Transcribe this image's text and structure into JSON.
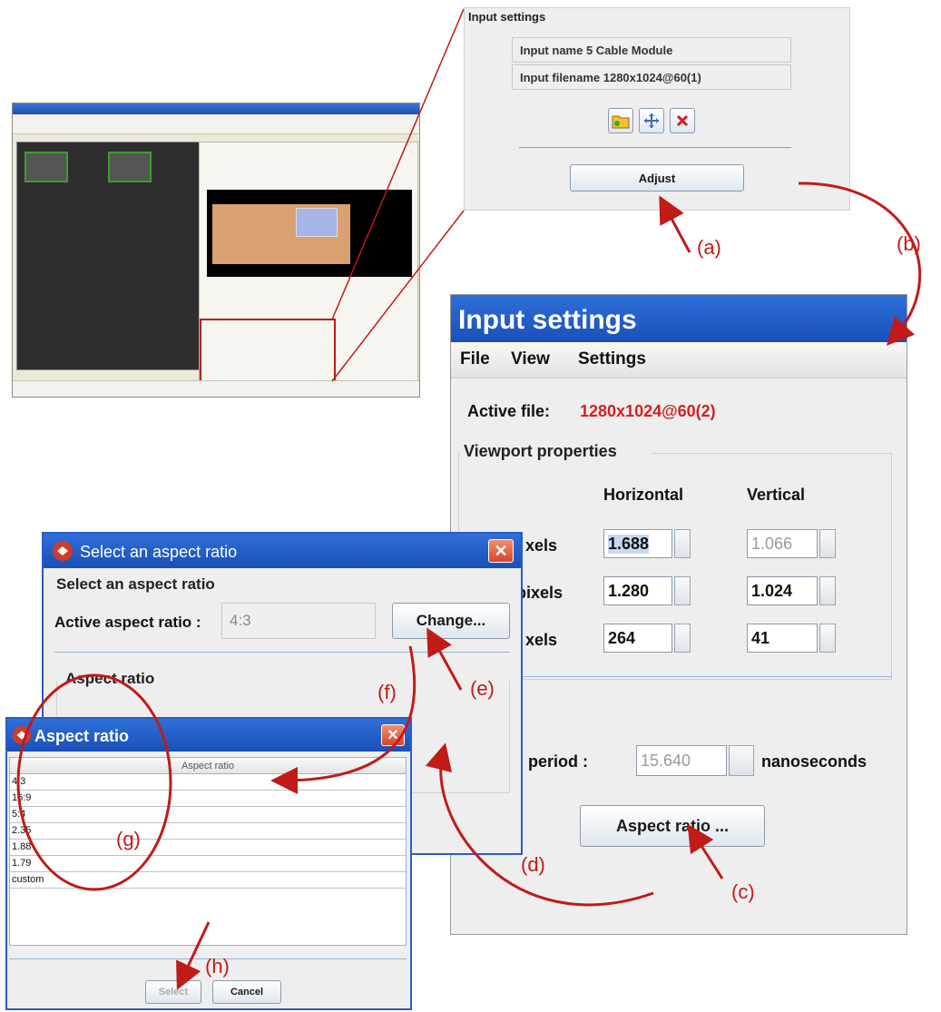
{
  "top_panel": {
    "group_title": "Input settings",
    "input_name": "Input name 5 Cable Module",
    "input_filename": "Input filename 1280x1024@60(1)",
    "icons": [
      "folder-icon",
      "move-icon",
      "delete-icon"
    ],
    "adjust_label": "Adjust"
  },
  "input_dialog": {
    "title": "Input settings",
    "menu": [
      "File",
      "View",
      "Settings"
    ],
    "active_file_label": "Active file:",
    "active_file_value": "1280x1024@60(2)",
    "viewport_title": "Viewport properties",
    "col_horizontal": "Horizontal",
    "col_vertical": "Vertical",
    "rows": [
      {
        "label": "xels",
        "h": "1.688",
        "v": "1.066"
      },
      {
        "label": "pixels",
        "h": "1.280",
        "v": "1.024"
      },
      {
        "label": "xels",
        "h": "264",
        "v": "41"
      }
    ],
    "period_label": "ital period :",
    "period_value": "15.640",
    "period_unit": "nanoseconds",
    "aspect_button": "Aspect ratio ..."
  },
  "select_dialog": {
    "title": "Select an aspect ratio",
    "group_title": "Select an aspect ratio",
    "active_label": "Active aspect ratio :",
    "active_value": "4:3",
    "change_button": "Change...",
    "aspect_group": "Aspect ratio"
  },
  "aspect_dialog": {
    "title": "Aspect ratio",
    "column_header": "Aspect ratio",
    "items": [
      "4:3",
      "16:9",
      "5:4",
      "2.35",
      "1.88",
      "1.79",
      "custom"
    ],
    "select_button": "Select",
    "cancel_button": "Cancel"
  },
  "callouts": {
    "a": "(a)",
    "b": "(b)",
    "c": "(c)",
    "d": "(d)",
    "e": "(e)",
    "f": "(f)",
    "g": "(g)",
    "h": "(h)"
  },
  "colors": {
    "title_blue": "#1a4fb8",
    "callout_red": "#c11b17",
    "thumbnail_orange": "#d9a071"
  }
}
